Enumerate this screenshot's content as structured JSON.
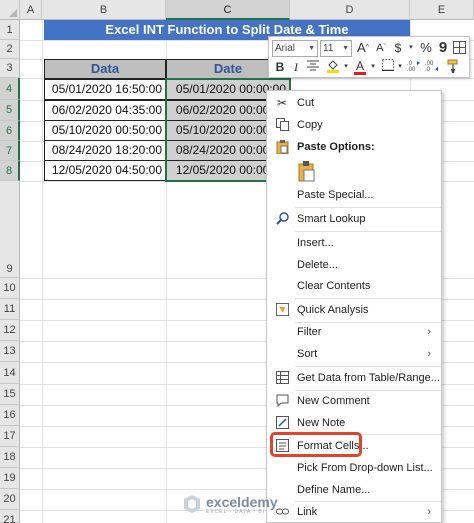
{
  "sheet": {
    "columns": [
      "A",
      "B",
      "C",
      "D",
      "E"
    ],
    "rows": [
      "1",
      "2",
      "3",
      "4",
      "5",
      "6",
      "7",
      "8",
      "9",
      "10",
      "11",
      "12",
      "13",
      "14",
      "15",
      "16",
      "17",
      "18",
      "19",
      "20",
      "21"
    ],
    "title": "Excel INT Function to Split Date & Time",
    "headers": [
      "Data",
      "Date"
    ],
    "data": [
      [
        "05/01/2020 16:50:00",
        "05/01/2020 00:00:00"
      ],
      [
        "06/02/2020 04:35:00",
        "06/02/2020 00:00:00"
      ],
      [
        "05/10/2020 00:50:00",
        "05/10/2020 00:00:00"
      ],
      [
        "08/24/2020 18:20:00",
        "08/24/2020 00:00:00"
      ],
      [
        "12/05/2020 04:50:00",
        "12/05/2020 00:00:00"
      ]
    ]
  },
  "mini_toolbar": {
    "font": "Arial",
    "size": "11",
    "grow": "A",
    "shrink": "A",
    "currency": "$",
    "percent": "%",
    "comma": "9",
    "bold": "B",
    "italic": "I",
    "font_color": "A"
  },
  "context_menu": {
    "cut": "Cut",
    "copy": "Copy",
    "paste_options": "Paste Options:",
    "paste_special": "Paste Special...",
    "smart_lookup": "Smart Lookup",
    "insert": "Insert...",
    "delete": "Delete...",
    "clear_contents": "Clear Contents",
    "quick_analysis": "Quick Analysis",
    "filter": "Filter",
    "sort": "Sort",
    "get_data": "Get Data from Table/Range...",
    "new_comment": "New Comment",
    "new_note": "New Note",
    "format_cells": "Format Cells...",
    "pick_list": "Pick From Drop-down List...",
    "define_name": "Define Name...",
    "link": "Link"
  },
  "watermark": {
    "name": "exceldemy",
    "tagline": "EXCEL · DATA · BI"
  },
  "colors": {
    "banner": "#4472c4",
    "header_fill": "#bfbfbf",
    "selection": "#217346",
    "highlight": "#e0452b"
  }
}
